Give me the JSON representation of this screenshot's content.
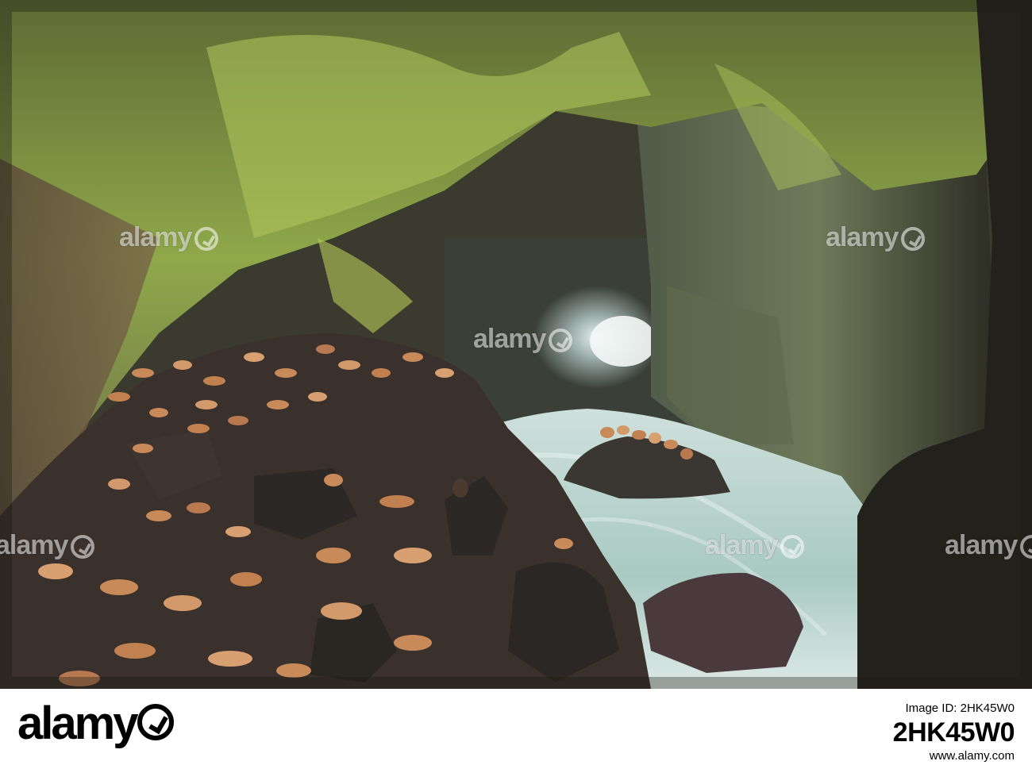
{
  "photo": {
    "subject": "sea-cave-with-sea-lions",
    "colors": {
      "moss": "#8fa84a",
      "rock_dark": "#2b2823",
      "water": "#b9d3cc",
      "sea_lion": "#c98a5a"
    }
  },
  "watermarks": [
    {
      "text": "alamy"
    },
    {
      "text": "alamy"
    },
    {
      "text": "alamy"
    },
    {
      "text": "alamy"
    },
    {
      "text": "alamy"
    },
    {
      "text": "alamy"
    }
  ],
  "footer": {
    "brand": "alamy",
    "image_id_label": "Image ID: 2HK45W0",
    "image_id": "2HK45W0",
    "site": "www.alamy.com"
  }
}
